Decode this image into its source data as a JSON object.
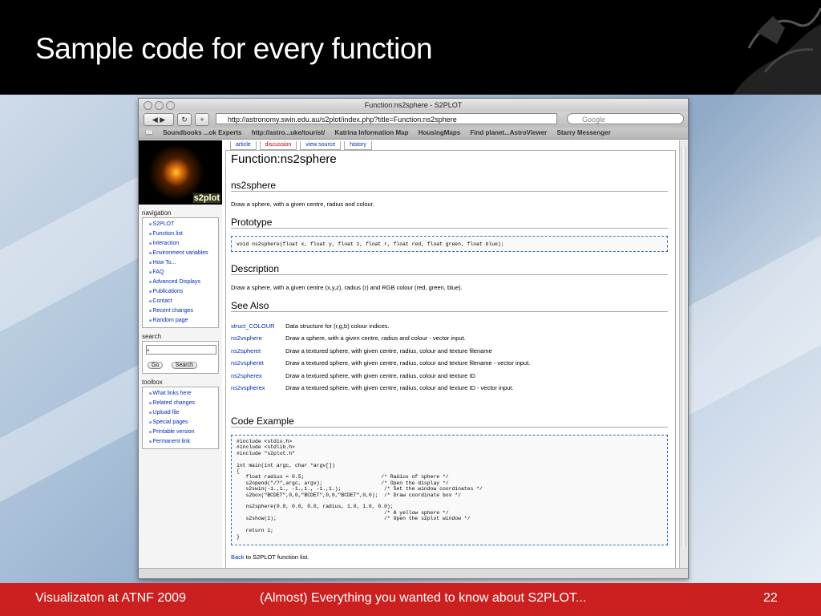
{
  "slide": {
    "title": "Sample code for every function",
    "footer_left": "Visualizaton at ATNF 2009",
    "footer_center": "(Almost) Everything you wanted to know about S2PLOT...",
    "footer_right": "22"
  },
  "browser": {
    "window_title": "Function:ns2sphere - S2PLOT",
    "url": "http://astronomy.swin.edu.au/s2plot/index.php?title=Function:ns2sphere",
    "search_placeholder": "Google",
    "bookmarks": [
      "Soundbooks ...ok Experts",
      "http://astro...uke/tourist/",
      "Katrina Information Map",
      "HousingMaps",
      "Find planet...AstroViewer",
      "Starry Messenger"
    ]
  },
  "wiki": {
    "logo_text": "s2plot",
    "tabs": [
      "article",
      "discussion",
      "view source",
      "history"
    ],
    "navigation_title": "navigation",
    "navigation": [
      "S2PLOT",
      "Function list",
      "Interaction",
      "Environment variables",
      "How To...",
      "FAQ",
      "Advanced Displays",
      "Publications",
      "Contact",
      "Recent changes",
      "Random page"
    ],
    "search_title": "search",
    "go_label": "Go",
    "search_label": "Search",
    "toolbox_title": "toolbox",
    "toolbox": [
      "What links here",
      "Related changes",
      "Upload file",
      "Special pages",
      "Printable version",
      "Permanent link"
    ]
  },
  "article": {
    "title": "Function:ns2sphere",
    "h_name": "ns2sphere",
    "summary": "Draw a sphere, with a given centre, radius and colour.",
    "h_prototype": "Prototype",
    "prototype": "void ns2sphere(float x, float y, float z, float r, float red, float green, float blue);",
    "h_description": "Description",
    "description": "Draw a sphere, with a given centre (x,y,z), radius (r) and RGB colour (red, green, blue).",
    "h_see_also": "See Also",
    "see_also": [
      {
        "name": "struct_COLOUR",
        "desc": "Data structure for (r,g,b) colour indices."
      },
      {
        "name": "ns2vsphere",
        "desc": "Draw a sphere, with a given centre, radius and colour - vector input."
      },
      {
        "name": "ns2spheret",
        "desc": "Draw a textured sphere, with given centre, radius, colour and texture filename"
      },
      {
        "name": "ns2vspheret",
        "desc": "Draw a textured sphere, with given centre, radius, colour and texture filename - vector input."
      },
      {
        "name": "ns2spherex",
        "desc": "Draw a textured sphere, with given centre, radius, colour and texture ID"
      },
      {
        "name": "ns2vspherex",
        "desc": "Draw a textured sphere, with given centre, radius, colour and texture ID - vector input."
      }
    ],
    "h_code": "Code Example",
    "code": "#include <stdio.h>\n#include <stdlib.h>\n#include \"s2plot.h\"\n\nint main(int argc, char *argv[])\n{\n   float radius = 0.5;                         /* Radius of sphere */\n   s2opend(\"/?\",argc, argv);                   /* Open the display */\n   s2swin(-1.,1., -1.,1., -1.,1.);              /* Set the window coordinates */\n   s2box(\"BCDET\",0,0,\"BCDET\",0,0,\"BCDET\",0,0);  /* Draw coordinate box */\n\n   ns2sphere(0.0, 0.0, 0.0, radius, 1.0, 1.0, 0.0);\n                                                /* A yellow sphere */\n   s2show(1);                                   /* Open the s2plot window */\n\n   return 1;\n}",
    "back_link": "Back",
    "back_rest": "to S2PLOT function list."
  }
}
